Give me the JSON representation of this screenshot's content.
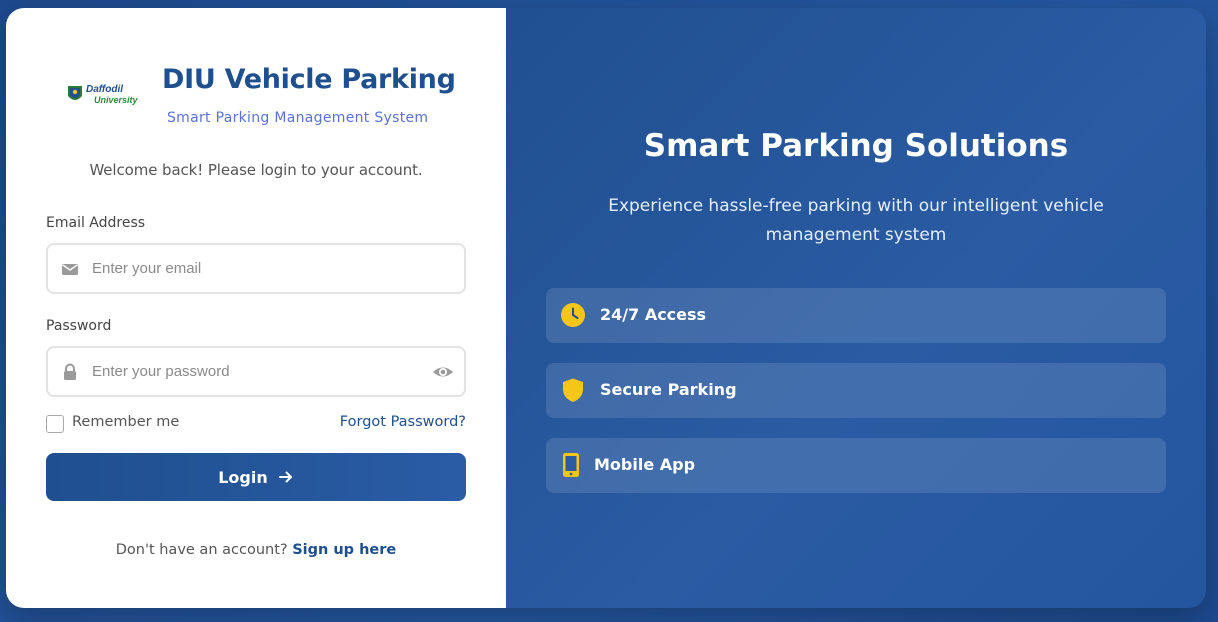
{
  "brand": {
    "logo_text": "Daffodil",
    "logo_subtext": "University",
    "title": "DIU Vehicle Parking",
    "subtitle": "Smart Parking Management System"
  },
  "login": {
    "welcome": "Welcome back! Please login to your account.",
    "email_label": "Email Address",
    "email_placeholder": "Enter your email",
    "password_label": "Password",
    "password_placeholder": "Enter your password",
    "remember_label": "Remember me",
    "forgot_label": "Forgot Password?",
    "submit_label": "Login",
    "signup_prompt": "Don't have an account?",
    "signup_link": "Sign up here"
  },
  "hero": {
    "title": "Smart Parking Solutions",
    "description": "Experience hassle-free parking with our intelligent vehicle management system",
    "features": [
      {
        "label": "24/7 Access",
        "icon": "clock-icon"
      },
      {
        "label": "Secure Parking",
        "icon": "shield-icon"
      },
      {
        "label": "Mobile App",
        "icon": "mobile-icon"
      }
    ]
  },
  "colors": {
    "primary": "#1e4f8e",
    "accent_subtitle": "#5a72d6",
    "icon_yellow": "#f5c518",
    "page_background": "#2557a0"
  }
}
